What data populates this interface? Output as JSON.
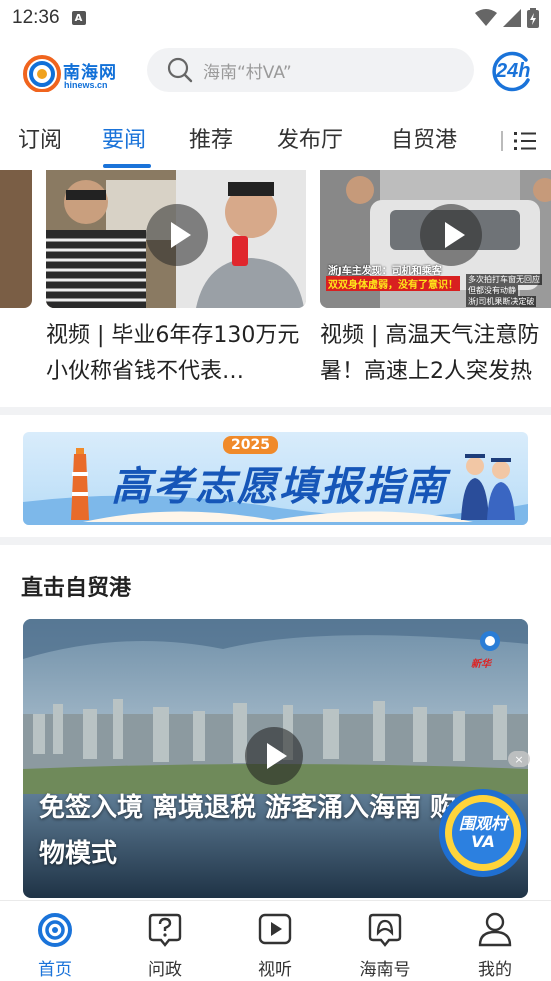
{
  "status_bar": {
    "time": "12:36",
    "notif_letter": "A"
  },
  "header": {
    "logo_text": "南海网",
    "logo_sub": "hinews.cn",
    "search_placeholder": "海南“村VA”",
    "btn_24h": "24h"
  },
  "tabs": [
    {
      "label": "订阅",
      "active": false
    },
    {
      "label": "要闻",
      "active": true
    },
    {
      "label": "推荐",
      "active": false
    },
    {
      "label": "发布厅",
      "active": false
    },
    {
      "label": "自贸港",
      "active": false
    }
  ],
  "video_cards": [
    {
      "title": "视频 | 毕业6年存130万元小伙称省钱不代表…"
    },
    {
      "title": "视频 | 高温天气注意防暑！高速上2人突发热",
      "overlay_lines": [
        "浙J车主发现：司机和乘客",
        "双双身体虚弱，没有了意识！",
        "多次拍打车窗无回应",
        "但都没有动静",
        "浙J司机果断决定破"
      ]
    }
  ],
  "banner": {
    "year": "2025",
    "title": "高考志愿填报指南"
  },
  "section": {
    "title": "直击自贸港"
  },
  "feature": {
    "title": "免签入境 离境退税 游客涌入海南 购物模式",
    "watermark": "新华",
    "badge_text": "围观村VA",
    "close": "×"
  },
  "bottom_nav": [
    {
      "label": "首页",
      "icon": "home-swirl-icon",
      "active": true
    },
    {
      "label": "问政",
      "icon": "question-icon",
      "active": false
    },
    {
      "label": "视听",
      "icon": "play-icon",
      "active": false
    },
    {
      "label": "海南号",
      "icon": "hainan-icon",
      "active": false
    },
    {
      "label": "我的",
      "icon": "user-icon",
      "active": false
    }
  ],
  "colors": {
    "accent": "#1a73d9",
    "search_bg": "#f1f2f4",
    "divider": "#f1f2f4"
  }
}
